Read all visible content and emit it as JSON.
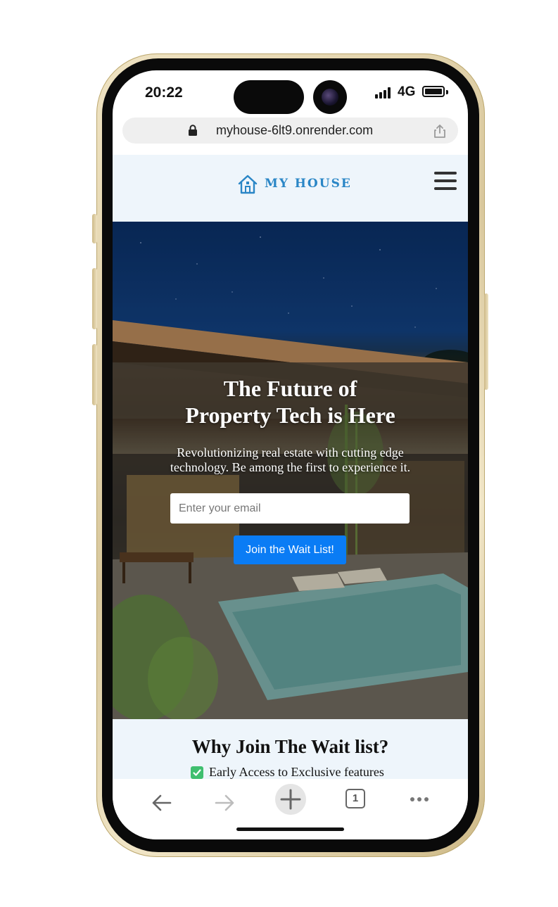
{
  "status_bar": {
    "time": "20:22",
    "network": "4G"
  },
  "browser": {
    "url": "myhouse-6lt9.onrender.com",
    "open_tabs": "1"
  },
  "site": {
    "logo_text": "MY HOUSE"
  },
  "hero": {
    "title_line1": "The Future of",
    "title_line2": "Property Tech is Here",
    "subtitle": "Revolutionizing real estate with cutting edge technology. Be among the first to experience it.",
    "email_placeholder": "Enter your email",
    "join_label": "Join the Wait List!"
  },
  "why": {
    "title": "Why Join The Wait list?",
    "features": [
      "Early Access to Exclusive features"
    ]
  },
  "icons": {
    "lock": "lock-icon",
    "share": "share-icon",
    "logo": "house-icon",
    "menu": "hamburger-icon",
    "check": "checkbox-checked-icon",
    "back": "arrow-left-icon",
    "forward": "arrow-right-icon",
    "new_tab": "plus-icon",
    "more": "ellipsis-icon"
  },
  "colors": {
    "accent": "#2a86c6",
    "button": "#0a7cf5",
    "section_bg": "#eef5fb",
    "check": "#3fbf6f"
  }
}
